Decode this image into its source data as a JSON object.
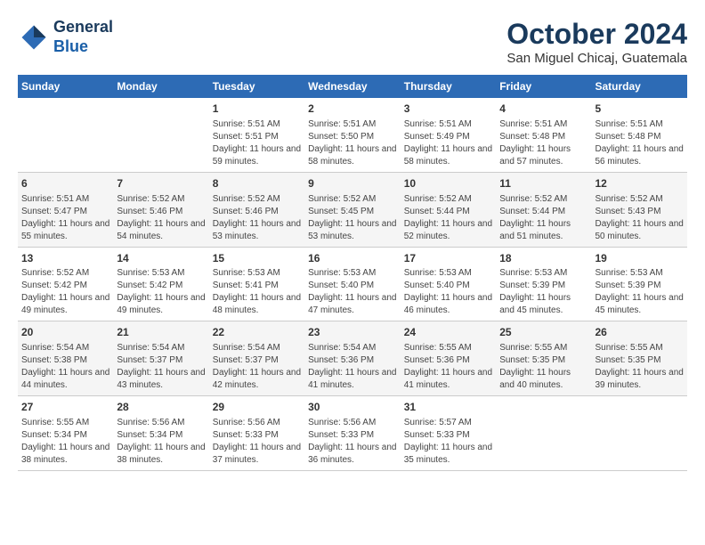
{
  "header": {
    "logo_line1": "General",
    "logo_line2": "Blue",
    "month": "October 2024",
    "location": "San Miguel Chicaj, Guatemala"
  },
  "days_of_week": [
    "Sunday",
    "Monday",
    "Tuesday",
    "Wednesday",
    "Thursday",
    "Friday",
    "Saturday"
  ],
  "weeks": [
    [
      {
        "day": "",
        "content": ""
      },
      {
        "day": "",
        "content": ""
      },
      {
        "day": "1",
        "content": "Sunrise: 5:51 AM\nSunset: 5:51 PM\nDaylight: 11 hours and 59 minutes."
      },
      {
        "day": "2",
        "content": "Sunrise: 5:51 AM\nSunset: 5:50 PM\nDaylight: 11 hours and 58 minutes."
      },
      {
        "day": "3",
        "content": "Sunrise: 5:51 AM\nSunset: 5:49 PM\nDaylight: 11 hours and 58 minutes."
      },
      {
        "day": "4",
        "content": "Sunrise: 5:51 AM\nSunset: 5:48 PM\nDaylight: 11 hours and 57 minutes."
      },
      {
        "day": "5",
        "content": "Sunrise: 5:51 AM\nSunset: 5:48 PM\nDaylight: 11 hours and 56 minutes."
      }
    ],
    [
      {
        "day": "6",
        "content": "Sunrise: 5:51 AM\nSunset: 5:47 PM\nDaylight: 11 hours and 55 minutes."
      },
      {
        "day": "7",
        "content": "Sunrise: 5:52 AM\nSunset: 5:46 PM\nDaylight: 11 hours and 54 minutes."
      },
      {
        "day": "8",
        "content": "Sunrise: 5:52 AM\nSunset: 5:46 PM\nDaylight: 11 hours and 53 minutes."
      },
      {
        "day": "9",
        "content": "Sunrise: 5:52 AM\nSunset: 5:45 PM\nDaylight: 11 hours and 53 minutes."
      },
      {
        "day": "10",
        "content": "Sunrise: 5:52 AM\nSunset: 5:44 PM\nDaylight: 11 hours and 52 minutes."
      },
      {
        "day": "11",
        "content": "Sunrise: 5:52 AM\nSunset: 5:44 PM\nDaylight: 11 hours and 51 minutes."
      },
      {
        "day": "12",
        "content": "Sunrise: 5:52 AM\nSunset: 5:43 PM\nDaylight: 11 hours and 50 minutes."
      }
    ],
    [
      {
        "day": "13",
        "content": "Sunrise: 5:52 AM\nSunset: 5:42 PM\nDaylight: 11 hours and 49 minutes."
      },
      {
        "day": "14",
        "content": "Sunrise: 5:53 AM\nSunset: 5:42 PM\nDaylight: 11 hours and 49 minutes."
      },
      {
        "day": "15",
        "content": "Sunrise: 5:53 AM\nSunset: 5:41 PM\nDaylight: 11 hours and 48 minutes."
      },
      {
        "day": "16",
        "content": "Sunrise: 5:53 AM\nSunset: 5:40 PM\nDaylight: 11 hours and 47 minutes."
      },
      {
        "day": "17",
        "content": "Sunrise: 5:53 AM\nSunset: 5:40 PM\nDaylight: 11 hours and 46 minutes."
      },
      {
        "day": "18",
        "content": "Sunrise: 5:53 AM\nSunset: 5:39 PM\nDaylight: 11 hours and 45 minutes."
      },
      {
        "day": "19",
        "content": "Sunrise: 5:53 AM\nSunset: 5:39 PM\nDaylight: 11 hours and 45 minutes."
      }
    ],
    [
      {
        "day": "20",
        "content": "Sunrise: 5:54 AM\nSunset: 5:38 PM\nDaylight: 11 hours and 44 minutes."
      },
      {
        "day": "21",
        "content": "Sunrise: 5:54 AM\nSunset: 5:37 PM\nDaylight: 11 hours and 43 minutes."
      },
      {
        "day": "22",
        "content": "Sunrise: 5:54 AM\nSunset: 5:37 PM\nDaylight: 11 hours and 42 minutes."
      },
      {
        "day": "23",
        "content": "Sunrise: 5:54 AM\nSunset: 5:36 PM\nDaylight: 11 hours and 41 minutes."
      },
      {
        "day": "24",
        "content": "Sunrise: 5:55 AM\nSunset: 5:36 PM\nDaylight: 11 hours and 41 minutes."
      },
      {
        "day": "25",
        "content": "Sunrise: 5:55 AM\nSunset: 5:35 PM\nDaylight: 11 hours and 40 minutes."
      },
      {
        "day": "26",
        "content": "Sunrise: 5:55 AM\nSunset: 5:35 PM\nDaylight: 11 hours and 39 minutes."
      }
    ],
    [
      {
        "day": "27",
        "content": "Sunrise: 5:55 AM\nSunset: 5:34 PM\nDaylight: 11 hours and 38 minutes."
      },
      {
        "day": "28",
        "content": "Sunrise: 5:56 AM\nSunset: 5:34 PM\nDaylight: 11 hours and 38 minutes."
      },
      {
        "day": "29",
        "content": "Sunrise: 5:56 AM\nSunset: 5:33 PM\nDaylight: 11 hours and 37 minutes."
      },
      {
        "day": "30",
        "content": "Sunrise: 5:56 AM\nSunset: 5:33 PM\nDaylight: 11 hours and 36 minutes."
      },
      {
        "day": "31",
        "content": "Sunrise: 5:57 AM\nSunset: 5:33 PM\nDaylight: 11 hours and 35 minutes."
      },
      {
        "day": "",
        "content": ""
      },
      {
        "day": "",
        "content": ""
      }
    ]
  ]
}
